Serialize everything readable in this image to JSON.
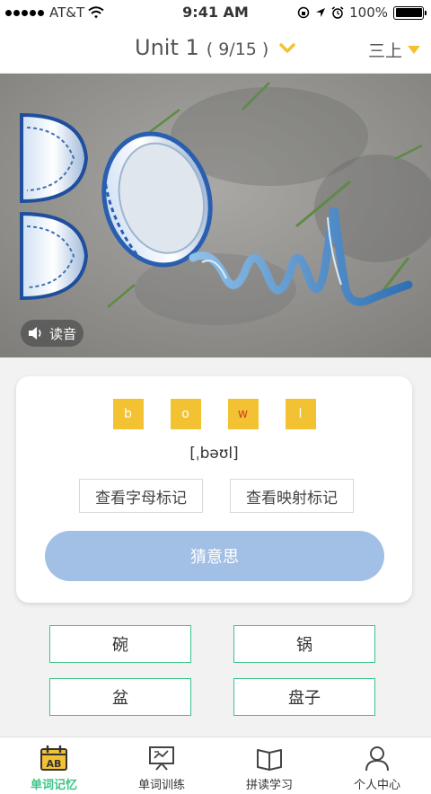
{
  "status_bar": {
    "carrier": "AT&T",
    "time": "9:41 AM",
    "battery": "100%",
    "battery_level": 1.0
  },
  "header": {
    "unit_title": "Unit 1",
    "unit_progress": "( 9/15 )",
    "grade": "三上",
    "accent_color": "#f3c233"
  },
  "hero": {
    "audio_label": "读音"
  },
  "word_card": {
    "letters": [
      {
        "char": "b",
        "highlight": false
      },
      {
        "char": "o",
        "highlight": false
      },
      {
        "char": "w",
        "highlight": true
      },
      {
        "char": "l",
        "highlight": false
      }
    ],
    "phonetic": "[ˌbəʊl]",
    "letter_mark_button": "查看字母标记",
    "mapping_mark_button": "查看映射标记",
    "guess_button": "猜意思"
  },
  "options": [
    "碗",
    "锅",
    "盆",
    "盘子"
  ],
  "tabs": [
    {
      "label": "单词记忆",
      "icon": "calendar-ab-icon",
      "active": true
    },
    {
      "label": "单词训练",
      "icon": "presentation-board-icon",
      "active": false
    },
    {
      "label": "拼读学习",
      "icon": "open-book-icon",
      "active": false
    },
    {
      "label": "个人中心",
      "icon": "person-icon",
      "active": false
    }
  ],
  "colors": {
    "primary_green": "#3cc488",
    "letter_yellow": "#f3c233",
    "guess_button_blue": "#a2bfe6"
  }
}
